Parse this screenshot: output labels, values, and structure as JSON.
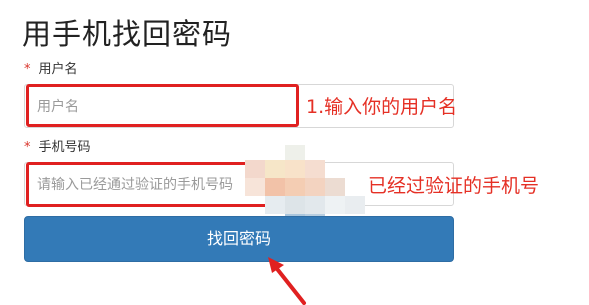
{
  "page": {
    "title": "用手机找回密码"
  },
  "form": {
    "required_mark": "*",
    "username_label": "用户名",
    "username_placeholder": "用户名",
    "phone_label": "手机号码",
    "phone_placeholder": "请输入已经通过验证的手机号码",
    "submit_label": "找回密码"
  },
  "annotations": {
    "step1": "1.输入你的用户名",
    "step2": "已经过验证的手机号"
  },
  "colors": {
    "primary_button": "#337ab7",
    "annotation_red": "#e53025",
    "required_red": "#d9332a"
  }
}
